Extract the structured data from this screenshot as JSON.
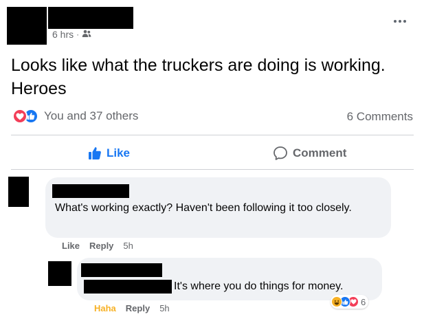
{
  "post": {
    "time": "6 hrs",
    "separator": "·",
    "privacy_icon": "friends-icon",
    "text": "Looks like what the truckers are doing is working. Heroes"
  },
  "reactions": {
    "label": "You and 37 others",
    "types": [
      "love",
      "like"
    ],
    "comments_count": "6 Comments"
  },
  "actions": {
    "like_label": "Like",
    "comment_label": "Comment"
  },
  "comments": [
    {
      "text": "What's working exactly? Haven't been following it too closely.",
      "like_label": "Like",
      "reply_label": "Reply",
      "time": "5h"
    },
    {
      "text": "It's where you do things for money.",
      "like_label": "Haha",
      "reply_label": "Reply",
      "time": "5h",
      "reaction_count": "6",
      "reaction_types": [
        "haha",
        "like",
        "love"
      ]
    }
  ],
  "colors": {
    "brand_blue": "#1877f2",
    "love_red": "#f33e58",
    "haha_yellow": "#f7b125",
    "secondary_text": "#65676b",
    "bubble_bg": "#f0f2f5"
  }
}
